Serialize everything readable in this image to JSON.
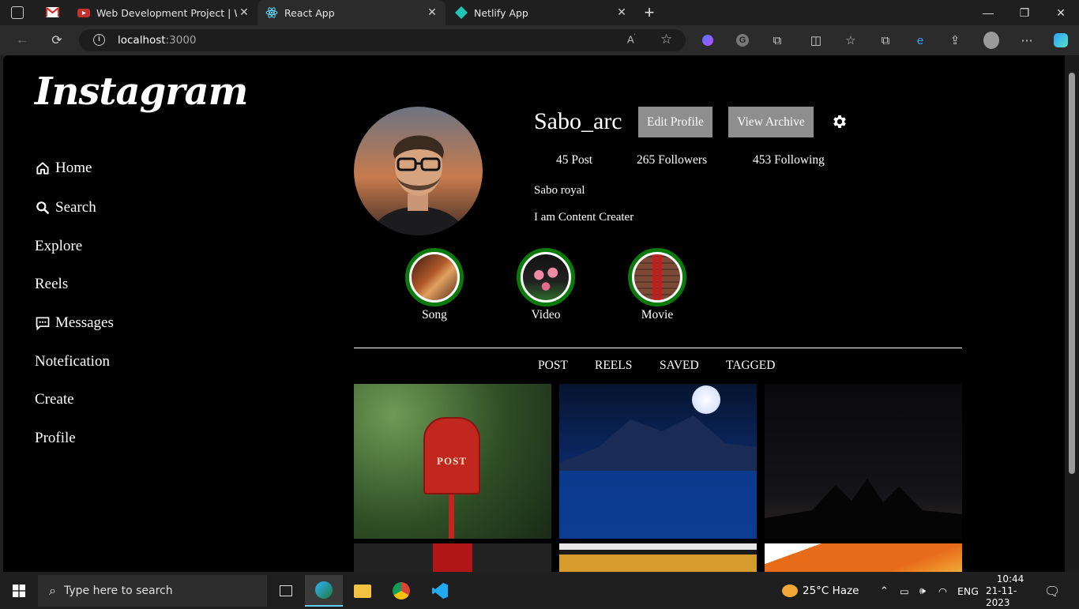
{
  "browser": {
    "tabs": [
      {
        "title": "Web Development Project | Web",
        "active": false
      },
      {
        "title": "React App",
        "active": true
      },
      {
        "title": "Netlify App",
        "active": false
      }
    ],
    "url_host": "localhost",
    "url_port": ":3000"
  },
  "sidebar": {
    "logo": "Instagram",
    "items": [
      {
        "label": "Home",
        "icon": "home-icon"
      },
      {
        "label": "Search",
        "icon": "search-icon"
      },
      {
        "label": "Explore"
      },
      {
        "label": "Reels"
      },
      {
        "label": "Messages",
        "icon": "message-icon"
      },
      {
        "label": "Notefication"
      },
      {
        "label": "Create"
      },
      {
        "label": "Profile"
      }
    ]
  },
  "profile": {
    "username": "Sabo_arc",
    "edit_label": "Edit Profile",
    "archive_label": "View Archive",
    "posts": "45 Post",
    "followers": "265 Followers",
    "following": "453 Following",
    "name": "Sabo royal",
    "bio": "I am Content Creater"
  },
  "stories": [
    {
      "label": "Song"
    },
    {
      "label": "Video"
    },
    {
      "label": "Movie"
    }
  ],
  "content_tabs": [
    "POST",
    "REELS",
    "SAVED",
    "TAGGED"
  ],
  "post_sign": "POST",
  "taskbar": {
    "search_placeholder": "Type here to search",
    "weather": "25°C  Haze",
    "lang": "ENG",
    "time": "10:44",
    "date": "21-11-2023"
  },
  "colors": {
    "story_ring": "#0a7b0a",
    "button": "#8e8e8e",
    "background": "#000000"
  }
}
